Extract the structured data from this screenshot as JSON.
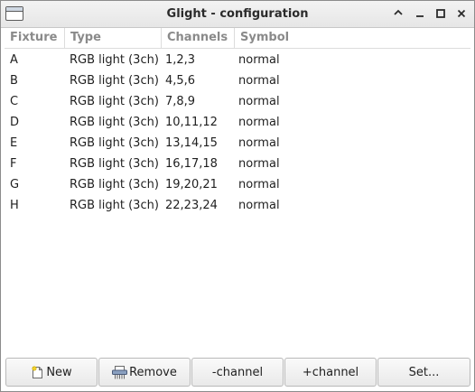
{
  "window": {
    "title": "Glight - configuration"
  },
  "table": {
    "columns": [
      "Fixture",
      "Type",
      "Channels",
      "Symbol"
    ],
    "rows": [
      {
        "fixture": "A",
        "type": "RGB light (3ch)",
        "channels": "1,2,3",
        "symbol": "normal"
      },
      {
        "fixture": "B",
        "type": "RGB light (3ch)",
        "channels": "4,5,6",
        "symbol": "normal"
      },
      {
        "fixture": "C",
        "type": "RGB light (3ch)",
        "channels": "7,8,9",
        "symbol": "normal"
      },
      {
        "fixture": "D",
        "type": "RGB light (3ch)",
        "channels": "10,11,12",
        "symbol": "normal"
      },
      {
        "fixture": "E",
        "type": "RGB light (3ch)",
        "channels": "13,14,15",
        "symbol": "normal"
      },
      {
        "fixture": "F",
        "type": "RGB light (3ch)",
        "channels": "16,17,18",
        "symbol": "normal"
      },
      {
        "fixture": "G",
        "type": "RGB light (3ch)",
        "channels": "19,20,21",
        "symbol": "normal"
      },
      {
        "fixture": "H",
        "type": "RGB light (3ch)",
        "channels": "22,23,24",
        "symbol": "normal"
      }
    ]
  },
  "buttons": {
    "new_label": "New",
    "new_icon": "new-document-icon",
    "remove_label": "Remove",
    "remove_icon": "shredder-icon",
    "minus_channel_label": "-channel",
    "plus_channel_label": "+channel",
    "set_label": "Set..."
  }
}
